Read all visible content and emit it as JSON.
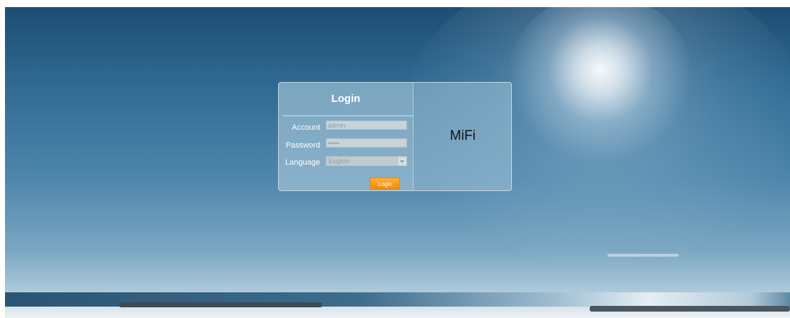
{
  "login": {
    "title": "Login",
    "account_label": "Account",
    "account_value": "admin",
    "password_label": "Password",
    "password_value": "•••••",
    "language_label": "Language",
    "language_selected": "English",
    "button_label": "Login"
  },
  "brand": {
    "name": "MiFi"
  },
  "colors": {
    "accent_button": "#f69a1e",
    "sky_dark": "#1e4d72",
    "panel_text": "#ffffff",
    "brand_text": "#111111"
  },
  "icons": {
    "dropdown": "chevron-down-icon"
  }
}
